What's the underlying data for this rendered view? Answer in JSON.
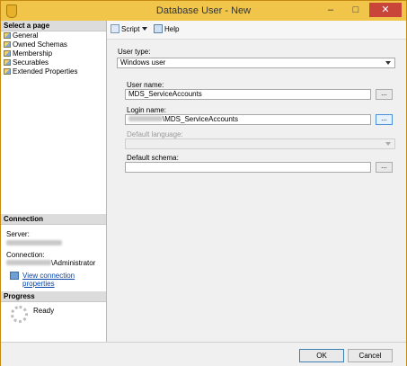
{
  "window": {
    "title": "Database User - New"
  },
  "left_pane": {
    "select_page_header": "Select a page",
    "pages": [
      "General",
      "Owned Schemas",
      "Membership",
      "Securables",
      "Extended Properties"
    ],
    "connection_header": "Connection",
    "server_label": "Server:",
    "connection_label": "Connection:",
    "connection_value_suffix": "\\Administrator",
    "view_connection_properties": "View connection properties",
    "progress_header": "Progress",
    "progress_status": "Ready"
  },
  "toolbar": {
    "script_label": "Script",
    "help_label": "Help"
  },
  "form": {
    "user_type_label": "User type:",
    "user_type_value": "Windows user",
    "user_name_label": "User name:",
    "user_name_value": "MDS_ServiceAccounts",
    "login_name_label": "Login name:",
    "login_name_suffix": "\\MDS_ServiceAccounts",
    "default_language_label": "Default language:",
    "default_schema_label": "Default schema:",
    "browse_label": "..."
  },
  "footer": {
    "ok_label": "OK",
    "cancel_label": "Cancel"
  }
}
